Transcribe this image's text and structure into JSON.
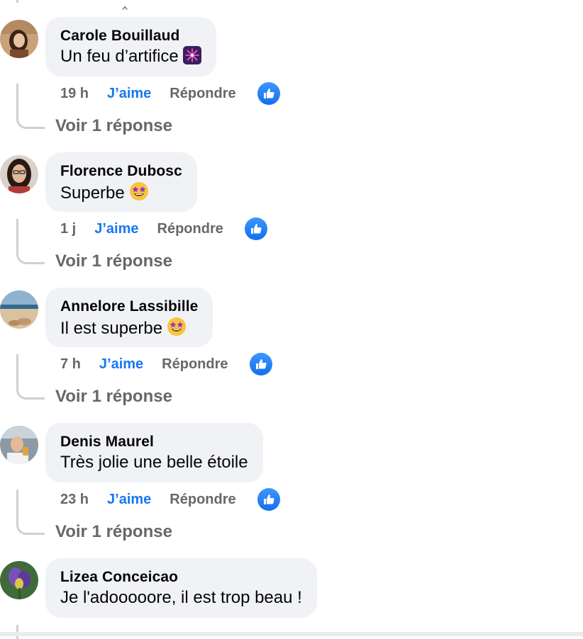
{
  "comments": [
    {
      "author": "Carole Bouillaud",
      "text": "Un feu d’artifice",
      "emoji": "fireworks-emoji",
      "time": "19 h",
      "like_label": "J’aime",
      "reply_label": "Répondre",
      "reaction": "like-reaction-icon",
      "replies_label": "Voir 1 réponse"
    },
    {
      "author": "Florence Dubosc",
      "text": "Superbe",
      "emoji": "star-struck-emoji",
      "time": "1 j",
      "like_label": "J’aime",
      "reply_label": "Répondre",
      "reaction": "like-reaction-icon",
      "replies_label": "Voir 1 réponse"
    },
    {
      "author": "Annelore Lassibille",
      "text": "Il est superbe",
      "emoji": "star-struck-emoji",
      "time": "7 h",
      "like_label": "J’aime",
      "reply_label": "Répondre",
      "reaction": "like-reaction-icon",
      "replies_label": "Voir 1 réponse"
    },
    {
      "author": "Denis Maurel",
      "text": "Très jolie une belle étoile",
      "time": "23 h",
      "like_label": "J’aime",
      "reply_label": "Répondre",
      "reaction": "like-reaction-icon",
      "replies_label": "Voir 1 réponse"
    },
    {
      "author": "Lizea Conceicao",
      "text": "Je l'adooooore, il est trop beau !"
    }
  ],
  "colors": {
    "bubble": "#f0f2f5",
    "like_blue": "#1877f2",
    "muted": "#65676b",
    "connector": "#ced0d4"
  }
}
